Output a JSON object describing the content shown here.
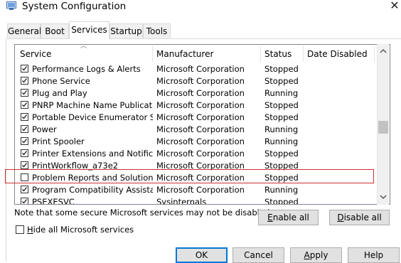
{
  "window": {
    "title": "System Configuration"
  },
  "tabs": [
    {
      "label": "General",
      "active": false
    },
    {
      "label": "Boot",
      "active": false
    },
    {
      "label": "Services",
      "active": true
    },
    {
      "label": "Startup",
      "active": false
    },
    {
      "label": "Tools",
      "active": false
    }
  ],
  "table": {
    "columns": [
      "Service",
      "Manufacturer",
      "Status",
      "Date Disabled"
    ],
    "rows": [
      {
        "checked": true,
        "service": "Performance Logs & Alerts",
        "manufacturer": "Microsoft Corporation",
        "status": "Stopped"
      },
      {
        "checked": true,
        "service": "Phone Service",
        "manufacturer": "Microsoft Corporation",
        "status": "Stopped"
      },
      {
        "checked": true,
        "service": "Plug and Play",
        "manufacturer": "Microsoft Corporation",
        "status": "Running"
      },
      {
        "checked": true,
        "service": "PNRP Machine Name Publication ...",
        "manufacturer": "Microsoft Corporation",
        "status": "Stopped"
      },
      {
        "checked": true,
        "service": "Portable Device Enumerator Ser...",
        "manufacturer": "Microsoft Corporation",
        "status": "Stopped"
      },
      {
        "checked": true,
        "service": "Power",
        "manufacturer": "Microsoft Corporation",
        "status": "Running"
      },
      {
        "checked": true,
        "service": "Print Spooler",
        "manufacturer": "Microsoft Corporation",
        "status": "Running"
      },
      {
        "checked": true,
        "service": "Printer Extensions and Notificati",
        "manufacturer": "Microsoft Corporation",
        "status": "Stopped"
      },
      {
        "checked": true,
        "service": "PrintWorkflow_a73e2",
        "manufacturer": "Microsoft Corporation",
        "status": "Stopped"
      },
      {
        "checked": false,
        "service": "Problem Reports and Solutions C...",
        "manufacturer": "Microsoft Corporation",
        "status": "Stopped"
      },
      {
        "checked": true,
        "service": "Program Compatibility Assistant ...",
        "manufacturer": "Microsoft Corporation",
        "status": "Running"
      },
      {
        "checked": true,
        "service": "PSEXESVC",
        "manufacturer": "Sysinternals",
        "status": "Stopped"
      }
    ]
  },
  "note": "Note that some secure Microsoft services may not be disabled.",
  "buttons": {
    "enable_all": {
      "mnemonic": "E",
      "rest": "nable all"
    },
    "disable_all": {
      "mnemonic": "D",
      "rest": "isable all"
    },
    "ok": "OK",
    "cancel": "Cancel",
    "apply": {
      "mnemonic": "A",
      "rest": "pply"
    },
    "help": "Help"
  },
  "hide_ms": {
    "checked": false,
    "mnemonic": "H",
    "rest": "ide all Microsoft services"
  },
  "colors": {
    "highlight": "#d12f2f",
    "accent": "#0078d7"
  }
}
